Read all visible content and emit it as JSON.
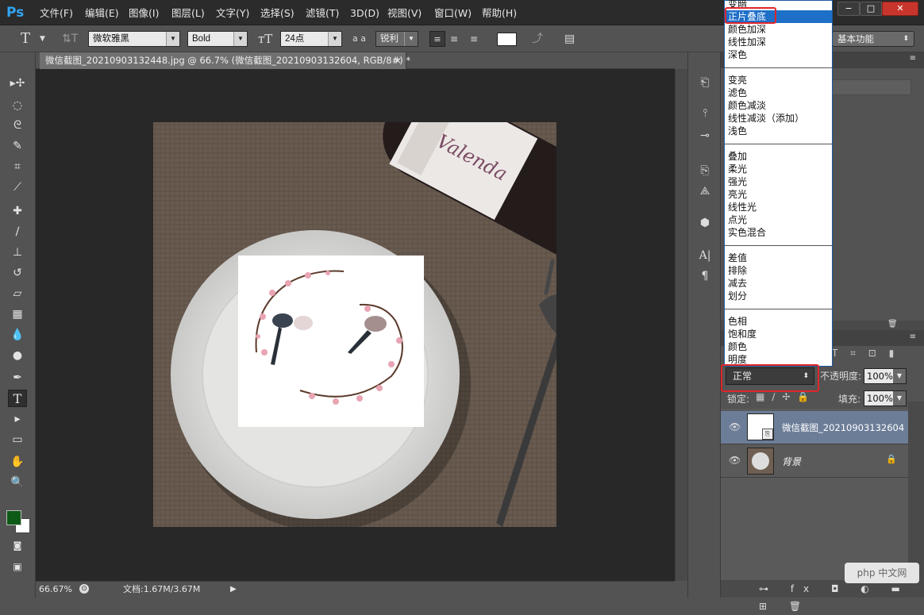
{
  "app": {
    "logo": "Ps"
  },
  "menu": [
    "文件(F)",
    "编辑(E)",
    "图像(I)",
    "图层(L)",
    "文字(Y)",
    "选择(S)",
    "滤镜(T)",
    "3D(D)",
    "视图(V)",
    "窗口(W)",
    "帮助(H)"
  ],
  "window_controls": {
    "minimize": "−",
    "restore": "□",
    "close": "✕"
  },
  "options": {
    "font_family": "微软雅黑",
    "font_style": "Bold",
    "font_size": "24点",
    "antialias_icon": "a a",
    "antialias": "锐利",
    "workspace": "基本功能"
  },
  "document": {
    "tab_title": "微信截图_20210903132448.jpg @ 66.7% (微信截图_20210903132604, RGB/8#) *",
    "tab_close": "×",
    "zoom": "66.67%",
    "doc_size": "文档:1.67M/3.67M"
  },
  "colors": {
    "foreground": "#0e5a17",
    "background": "#ffffff",
    "accent": "#1e6fc8",
    "highlight_box": "#e0252a"
  },
  "blend_modes": {
    "groups": [
      [
        "变暗",
        "正片叠底",
        "颜色加深",
        "线性加深",
        "深色"
      ],
      [
        "变亮",
        "滤色",
        "颜色减淡",
        "线性减淡（添加）",
        "浅色"
      ],
      [
        "叠加",
        "柔光",
        "强光",
        "亮光",
        "线性光",
        "点光",
        "实色混合"
      ],
      [
        "差值",
        "排除",
        "减去",
        "划分"
      ],
      [
        "色相",
        "饱和度",
        "颜色",
        "明度"
      ]
    ],
    "selected": "正片叠底"
  },
  "layers_panel": {
    "blend_mode": "正常",
    "opacity_label": "不透明度:",
    "opacity": "100%",
    "lock_label": "锁定:",
    "fill_label": "填充:",
    "fill": "100%",
    "layers": [
      {
        "name": "微信截图_20210903132604",
        "selected": true
      },
      {
        "name": "背景",
        "selected": false
      }
    ]
  },
  "watermark": "php 中文网"
}
